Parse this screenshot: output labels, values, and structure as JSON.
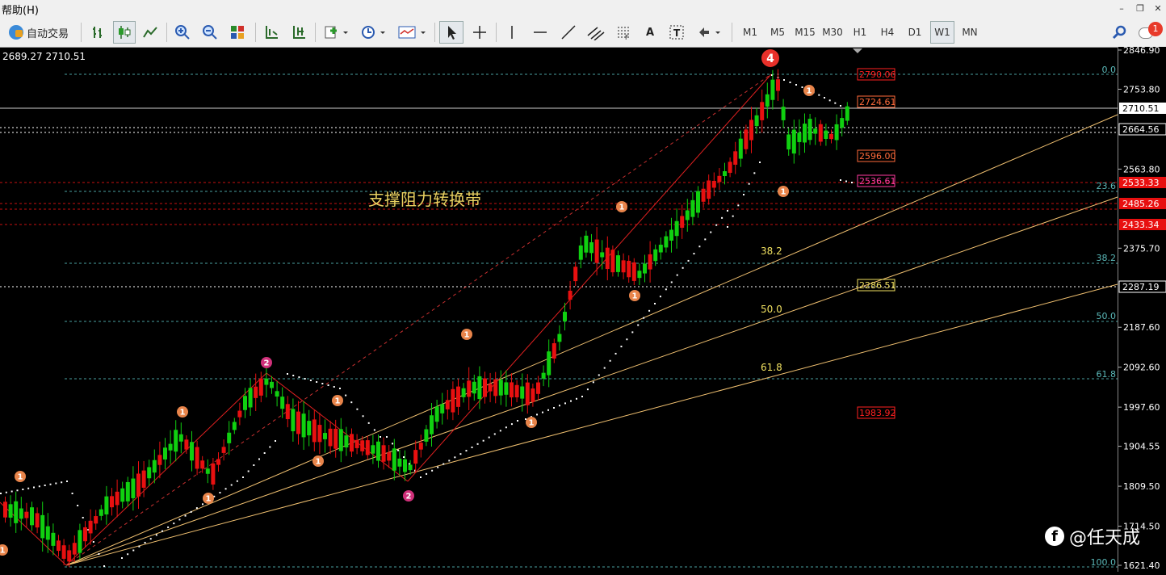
{
  "menu": {
    "help_label": "帮助(H)"
  },
  "toolbar": {
    "auto_trade_label": "自动交易",
    "timeframes": [
      "M1",
      "M5",
      "M15",
      "M30",
      "H1",
      "H4",
      "D1",
      "W1",
      "MN"
    ],
    "selected_timeframe": "W1",
    "notification_count": "1"
  },
  "chart": {
    "ohlc_readout": "2689.27 2710.51",
    "annotation": "支撑阻力转换带",
    "watermark": "@任天成",
    "price_axis": [
      "2846.90",
      "2753.80",
      "2563.80",
      "2375.70",
      "2187.60",
      "2092.60",
      "1997.60",
      "1904.55",
      "1809.50",
      "1714.50",
      "1621.40"
    ],
    "price_range": [
      1621.4,
      2846.9
    ],
    "price_markers": [
      {
        "value": "2710.51",
        "kind": "current"
      },
      {
        "value": "2664.56",
        "kind": "box"
      },
      {
        "value": "2533.33",
        "kind": "red"
      },
      {
        "value": "2485.26",
        "kind": "red"
      },
      {
        "value": "2433.34",
        "kind": "red"
      },
      {
        "value": "2287.19",
        "kind": "box"
      }
    ],
    "level_labels": [
      {
        "value": "2790.06",
        "color": "#ff2020"
      },
      {
        "value": "2724.61",
        "color": "#ff6a3a"
      },
      {
        "value": "2596.00",
        "color": "#ff6a3a"
      },
      {
        "value": "2536.61",
        "color": "#ff3aa0"
      },
      {
        "value": "2286.51",
        "color": "#f0e060"
      },
      {
        "value": "1983.92",
        "color": "#ff2020"
      }
    ],
    "fibo_right": [
      "0.0",
      "23.6",
      "38.2",
      "50.0",
      "61.8",
      "100.0"
    ],
    "fibo_mid": [
      "38.2",
      "50.0",
      "61.8"
    ],
    "wave_labels": [
      {
        "text": "1",
        "color": "#e8844a"
      },
      {
        "text": "1",
        "color": "#e8844a"
      },
      {
        "text": "1",
        "color": "#e8844a"
      },
      {
        "text": "1",
        "color": "#e8844a"
      },
      {
        "text": "1",
        "color": "#e8844a"
      },
      {
        "text": "1",
        "color": "#e8844a"
      },
      {
        "text": "1",
        "color": "#e8844a"
      },
      {
        "text": "1",
        "color": "#e8844a"
      },
      {
        "text": "1",
        "color": "#e8844a"
      },
      {
        "text": "1",
        "color": "#e8844a"
      },
      {
        "text": "1",
        "color": "#e8844a"
      },
      {
        "text": "1",
        "color": "#e8844a"
      },
      {
        "text": "2",
        "color": "#d0307a"
      },
      {
        "text": "2",
        "color": "#d0307a"
      },
      {
        "text": "4",
        "color": "#e8302a"
      }
    ]
  }
}
